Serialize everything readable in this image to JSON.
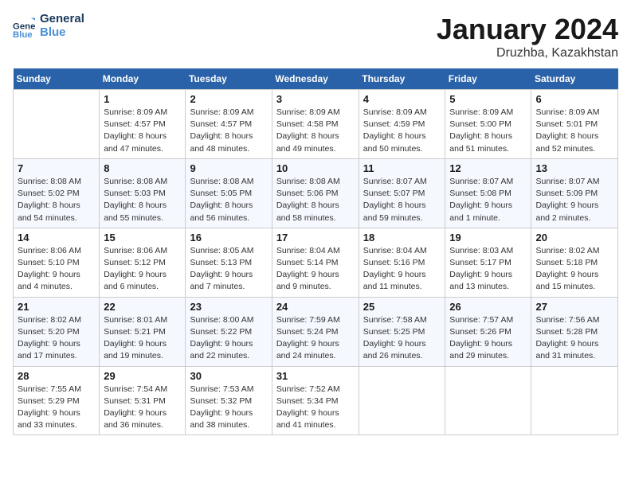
{
  "header": {
    "logo_line1": "General",
    "logo_line2": "Blue",
    "month_year": "January 2024",
    "location": "Druzhba, Kazakhstan"
  },
  "days_of_week": [
    "Sunday",
    "Monday",
    "Tuesday",
    "Wednesday",
    "Thursday",
    "Friday",
    "Saturday"
  ],
  "weeks": [
    [
      {
        "num": "",
        "empty": true
      },
      {
        "num": "1",
        "sunrise": "8:09 AM",
        "sunset": "4:57 PM",
        "daylight": "8 hours and 47 minutes."
      },
      {
        "num": "2",
        "sunrise": "8:09 AM",
        "sunset": "4:57 PM",
        "daylight": "8 hours and 48 minutes."
      },
      {
        "num": "3",
        "sunrise": "8:09 AM",
        "sunset": "4:58 PM",
        "daylight": "8 hours and 49 minutes."
      },
      {
        "num": "4",
        "sunrise": "8:09 AM",
        "sunset": "4:59 PM",
        "daylight": "8 hours and 50 minutes."
      },
      {
        "num": "5",
        "sunrise": "8:09 AM",
        "sunset": "5:00 PM",
        "daylight": "8 hours and 51 minutes."
      },
      {
        "num": "6",
        "sunrise": "8:09 AM",
        "sunset": "5:01 PM",
        "daylight": "8 hours and 52 minutes."
      }
    ],
    [
      {
        "num": "7",
        "sunrise": "8:08 AM",
        "sunset": "5:02 PM",
        "daylight": "8 hours and 54 minutes."
      },
      {
        "num": "8",
        "sunrise": "8:08 AM",
        "sunset": "5:03 PM",
        "daylight": "8 hours and 55 minutes."
      },
      {
        "num": "9",
        "sunrise": "8:08 AM",
        "sunset": "5:05 PM",
        "daylight": "8 hours and 56 minutes."
      },
      {
        "num": "10",
        "sunrise": "8:08 AM",
        "sunset": "5:06 PM",
        "daylight": "8 hours and 58 minutes."
      },
      {
        "num": "11",
        "sunrise": "8:07 AM",
        "sunset": "5:07 PM",
        "daylight": "8 hours and 59 minutes."
      },
      {
        "num": "12",
        "sunrise": "8:07 AM",
        "sunset": "5:08 PM",
        "daylight": "9 hours and 1 minute."
      },
      {
        "num": "13",
        "sunrise": "8:07 AM",
        "sunset": "5:09 PM",
        "daylight": "9 hours and 2 minutes."
      }
    ],
    [
      {
        "num": "14",
        "sunrise": "8:06 AM",
        "sunset": "5:10 PM",
        "daylight": "9 hours and 4 minutes."
      },
      {
        "num": "15",
        "sunrise": "8:06 AM",
        "sunset": "5:12 PM",
        "daylight": "9 hours and 6 minutes."
      },
      {
        "num": "16",
        "sunrise": "8:05 AM",
        "sunset": "5:13 PM",
        "daylight": "9 hours and 7 minutes."
      },
      {
        "num": "17",
        "sunrise": "8:04 AM",
        "sunset": "5:14 PM",
        "daylight": "9 hours and 9 minutes."
      },
      {
        "num": "18",
        "sunrise": "8:04 AM",
        "sunset": "5:16 PM",
        "daylight": "9 hours and 11 minutes."
      },
      {
        "num": "19",
        "sunrise": "8:03 AM",
        "sunset": "5:17 PM",
        "daylight": "9 hours and 13 minutes."
      },
      {
        "num": "20",
        "sunrise": "8:02 AM",
        "sunset": "5:18 PM",
        "daylight": "9 hours and 15 minutes."
      }
    ],
    [
      {
        "num": "21",
        "sunrise": "8:02 AM",
        "sunset": "5:20 PM",
        "daylight": "9 hours and 17 minutes."
      },
      {
        "num": "22",
        "sunrise": "8:01 AM",
        "sunset": "5:21 PM",
        "daylight": "9 hours and 19 minutes."
      },
      {
        "num": "23",
        "sunrise": "8:00 AM",
        "sunset": "5:22 PM",
        "daylight": "9 hours and 22 minutes."
      },
      {
        "num": "24",
        "sunrise": "7:59 AM",
        "sunset": "5:24 PM",
        "daylight": "9 hours and 24 minutes."
      },
      {
        "num": "25",
        "sunrise": "7:58 AM",
        "sunset": "5:25 PM",
        "daylight": "9 hours and 26 minutes."
      },
      {
        "num": "26",
        "sunrise": "7:57 AM",
        "sunset": "5:26 PM",
        "daylight": "9 hours and 29 minutes."
      },
      {
        "num": "27",
        "sunrise": "7:56 AM",
        "sunset": "5:28 PM",
        "daylight": "9 hours and 31 minutes."
      }
    ],
    [
      {
        "num": "28",
        "sunrise": "7:55 AM",
        "sunset": "5:29 PM",
        "daylight": "9 hours and 33 minutes."
      },
      {
        "num": "29",
        "sunrise": "7:54 AM",
        "sunset": "5:31 PM",
        "daylight": "9 hours and 36 minutes."
      },
      {
        "num": "30",
        "sunrise": "7:53 AM",
        "sunset": "5:32 PM",
        "daylight": "9 hours and 38 minutes."
      },
      {
        "num": "31",
        "sunrise": "7:52 AM",
        "sunset": "5:34 PM",
        "daylight": "9 hours and 41 minutes."
      },
      {
        "num": "",
        "empty": true
      },
      {
        "num": "",
        "empty": true
      },
      {
        "num": "",
        "empty": true
      }
    ]
  ]
}
